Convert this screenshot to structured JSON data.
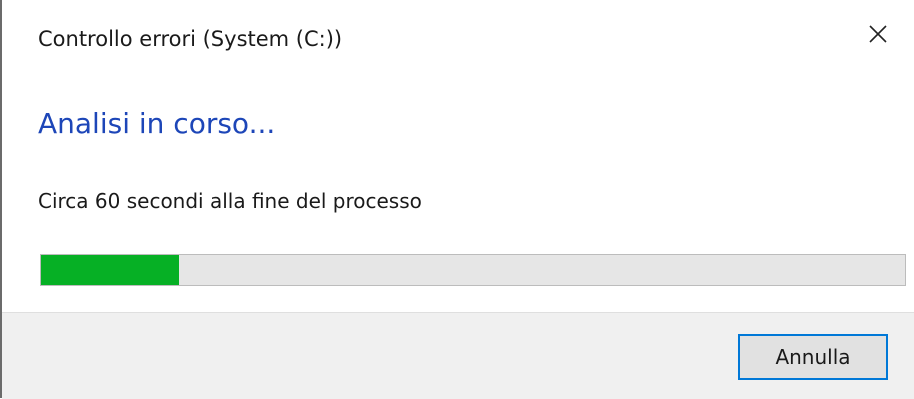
{
  "window": {
    "title": "Controllo errori (System (C:))",
    "close_icon": "close-icon"
  },
  "main": {
    "heading": "Analisi in corso...",
    "status_text": "Circa 60 secondi alla fine del processo",
    "progress": {
      "value_fraction": 0.16,
      "fill_color": "#06b025",
      "track_color": "#e6e6e6"
    }
  },
  "footer": {
    "cancel_label": "Annulla"
  },
  "colors": {
    "heading": "#1d46b8",
    "button_focus_border": "#0078d7"
  }
}
